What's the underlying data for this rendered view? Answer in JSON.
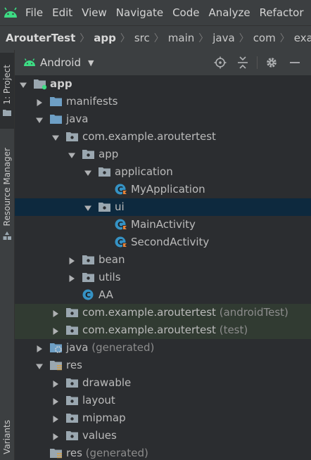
{
  "menubar": {
    "items": [
      {
        "label": "File"
      },
      {
        "label": "Edit"
      },
      {
        "label": "View"
      },
      {
        "label": "Navigate"
      },
      {
        "label": "Code"
      },
      {
        "label": "Analyze"
      },
      {
        "label": "Refactor"
      }
    ]
  },
  "breadcrumb": [
    "ArouterTest",
    "app",
    "src",
    "main",
    "java",
    "com",
    "example"
  ],
  "leftstrip": {
    "project_tab": "1: Project",
    "resource_tab": "Resource Manager",
    "variants_tab": "Variants"
  },
  "toolbar": {
    "view_label": "Android"
  },
  "tree": [
    {
      "label": "app",
      "suffix": "",
      "depth": 0,
      "arrow": "down",
      "icon": "module-icon",
      "bold": true
    },
    {
      "label": "manifests",
      "suffix": "",
      "depth": 1,
      "arrow": "right",
      "icon": "folder-icon"
    },
    {
      "label": "java",
      "suffix": "",
      "depth": 1,
      "arrow": "down",
      "icon": "folder-icon"
    },
    {
      "label": "com.example.aroutertest",
      "suffix": "",
      "depth": 2,
      "arrow": "down",
      "icon": "package-icon"
    },
    {
      "label": "app",
      "suffix": "",
      "depth": 3,
      "arrow": "down",
      "icon": "package-icon"
    },
    {
      "label": "application",
      "suffix": "",
      "depth": 4,
      "arrow": "down",
      "icon": "package-icon"
    },
    {
      "label": "MyApplication",
      "suffix": "",
      "depth": 5,
      "arrow": "none",
      "icon": "kotlin-class-icon"
    },
    {
      "label": "ui",
      "suffix": "",
      "depth": 4,
      "arrow": "down",
      "icon": "package-icon",
      "selected": true
    },
    {
      "label": "MainActivity",
      "suffix": "",
      "depth": 5,
      "arrow": "none",
      "icon": "kotlin-class-icon"
    },
    {
      "label": "SecondActivity",
      "suffix": "",
      "depth": 5,
      "arrow": "none",
      "icon": "kotlin-class-icon"
    },
    {
      "label": "bean",
      "suffix": "",
      "depth": 3,
      "arrow": "right",
      "icon": "package-icon"
    },
    {
      "label": "utils",
      "suffix": "",
      "depth": 3,
      "arrow": "right",
      "icon": "package-icon"
    },
    {
      "label": "AA",
      "suffix": "",
      "depth": 3,
      "arrow": "none",
      "icon": "class-icon"
    },
    {
      "label": "com.example.aroutertest",
      "suffix": "(androidTest)",
      "depth": 2,
      "arrow": "right",
      "icon": "package-icon",
      "test": true
    },
    {
      "label": "com.example.aroutertest",
      "suffix": "(test)",
      "depth": 2,
      "arrow": "right",
      "icon": "package-icon",
      "test": true
    },
    {
      "label": "java",
      "suffix": "(generated)",
      "depth": 1,
      "arrow": "right",
      "icon": "generated-folder-icon"
    },
    {
      "label": "res",
      "suffix": "",
      "depth": 1,
      "arrow": "down",
      "icon": "res-folder-icon"
    },
    {
      "label": "drawable",
      "suffix": "",
      "depth": 2,
      "arrow": "right",
      "icon": "package-icon"
    },
    {
      "label": "layout",
      "suffix": "",
      "depth": 2,
      "arrow": "right",
      "icon": "package-icon"
    },
    {
      "label": "mipmap",
      "suffix": "",
      "depth": 2,
      "arrow": "right",
      "icon": "package-icon"
    },
    {
      "label": "values",
      "suffix": "",
      "depth": 2,
      "arrow": "right",
      "icon": "package-icon"
    },
    {
      "label": "res",
      "suffix": "(generated)",
      "depth": 1,
      "arrow": "none",
      "icon": "res-folder-icon"
    }
  ],
  "colors": {
    "background": "#2b2d30",
    "toolbar": "#3c3f41",
    "selection": "#0d293e",
    "test_highlight": "#313b32",
    "folder_blue": "#6e9fc5",
    "folder_grey": "#9aa7b0",
    "android_green": "#3ddc84",
    "kotlin_orange": "#e8843a",
    "class_blue": "#3592c4"
  }
}
